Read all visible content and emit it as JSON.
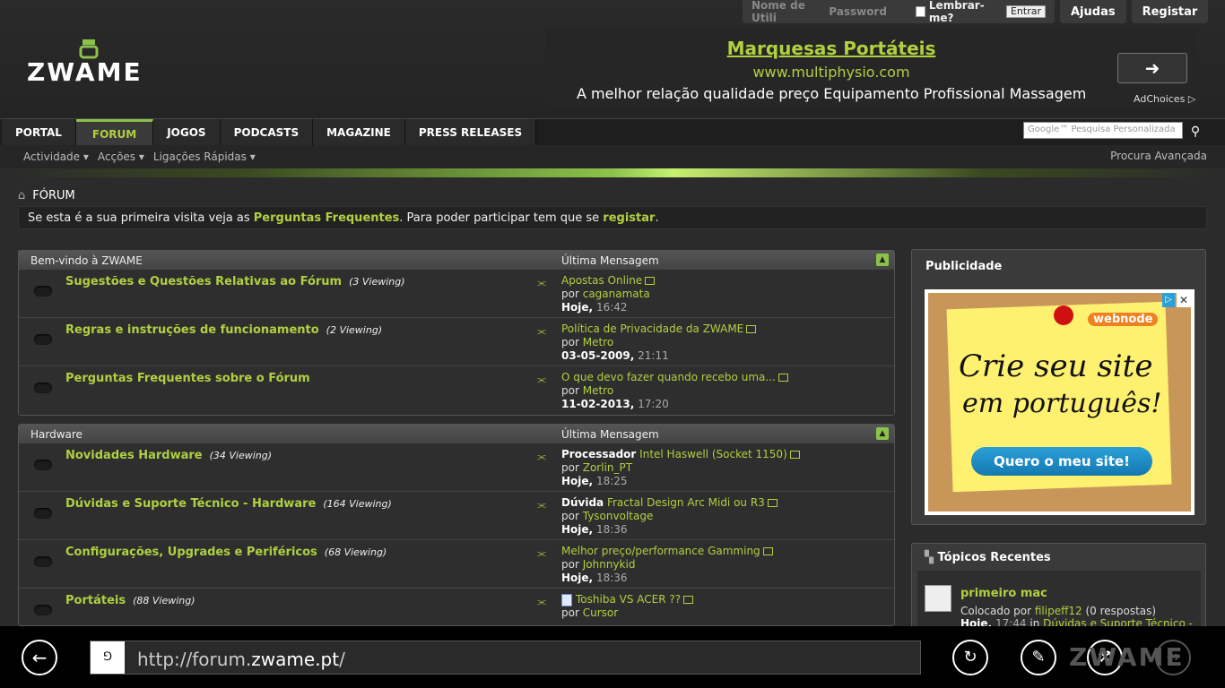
{
  "top": {
    "username_placeholder": "Nome de Utili",
    "password_placeholder": "Password",
    "remember": "Lembrar-me?",
    "login_btn": "Entrar",
    "help": "Ajudas",
    "register": "Registar"
  },
  "logo": "ZWAME",
  "ad": {
    "title": "Marquesas Portáteis",
    "url": "www.multiphysio.com",
    "desc": "A melhor relação qualidade preço Equipamento Profissional Massagem",
    "adchoices": "AdChoices"
  },
  "nav": {
    "tabs": [
      "PORTAL",
      "FORUM",
      "JOGOS",
      "PODCASTS",
      "MAGAZINE",
      "PRESS RELEASES"
    ],
    "search_placeholder": "Google™ Pesquisa Personalizada"
  },
  "subnav": {
    "items": [
      "Actividade ▾",
      "Acções ▾",
      "Ligações Rápidas ▾"
    ],
    "advanced": "Procura Avançada"
  },
  "breadcrumb": "FÓRUM",
  "notice": {
    "p1": "Se esta é a sua primeira visita veja as ",
    "faq": "Perguntas Frequentes",
    "p2": ". Para poder participar tem que se ",
    "reg": "registar",
    "p3": "."
  },
  "sections": [
    {
      "title": "Bem-vindo à ZWAME",
      "last_label": "Última Mensagem",
      "rows": [
        {
          "title": "Sugestões e Questões Relativas ao Fórum",
          "viewing": "(3 Viewing)",
          "prefix": "",
          "thread": "Apostas Online",
          "by_label": "por",
          "user": "caganamata",
          "date": "Hoje,",
          "time": "16:42"
        },
        {
          "title": "Regras e instruções de funcionamento",
          "viewing": "(2 Viewing)",
          "prefix": "",
          "thread": "Política de Privacidade da ZWAME",
          "by_label": "por",
          "user": "Metro",
          "date": "03-05-2009,",
          "time": "21:11"
        },
        {
          "title": "Perguntas Frequentes sobre o Fórum",
          "viewing": "",
          "prefix": "",
          "thread": "O que devo fazer quando recebo uma...",
          "by_label": "por",
          "user": "Metro",
          "date": "11-02-2013,",
          "time": "17:20"
        }
      ]
    },
    {
      "title": "Hardware",
      "last_label": "Última Mensagem",
      "rows": [
        {
          "title": "Novidades Hardware",
          "viewing": "(34 Viewing)",
          "prefix": "Processador",
          "thread": "Intel Haswell (Socket 1150)",
          "by_label": "por",
          "user": "Zorlin_PT",
          "date": "Hoje,",
          "time": "18:25"
        },
        {
          "title": "Dúvidas e Suporte Técnico - Hardware",
          "viewing": "(164 Viewing)",
          "prefix": "Dúvida",
          "thread": "Fractal Design Arc Midi ou R3",
          "by_label": "por",
          "user": "Tysonvoltage",
          "date": "Hoje,",
          "time": "18:36"
        },
        {
          "title": "Configurações, Upgrades e Periféricos",
          "viewing": "(68 Viewing)",
          "prefix": "",
          "thread": "Melhor preço/performance Gamming",
          "by_label": "por",
          "user": "Johnnykid",
          "date": "Hoje,",
          "time": "18:36"
        },
        {
          "title": "Portáteis",
          "viewing": "(88 Viewing)",
          "prefix": "",
          "thread": "Toshiba VS ACER ??",
          "by_label": "por",
          "user": "Cursor",
          "date": "",
          "time": ""
        }
      ]
    }
  ],
  "sidebar": {
    "ads_title": "Publicidade",
    "ad": {
      "brand": "webnode",
      "line1": "Crie seu site",
      "line2": "em português!",
      "cta": "Quero o meu site!"
    },
    "recent_title": "Tópicos Recentes",
    "recent": {
      "title": "primeiro mac",
      "posted_by": "Colocado por",
      "user": "filipeff12",
      "replies": "(0 respostas)",
      "date": "Hoje,",
      "time": "17:44",
      "in": "in",
      "forum": "Dúvidas e Suporte Técnico -"
    }
  },
  "browser": {
    "url_prefix": "http://forum.",
    "url_host": "zwame.pt",
    "url_suffix": "/",
    "logo": "ZWAME"
  }
}
